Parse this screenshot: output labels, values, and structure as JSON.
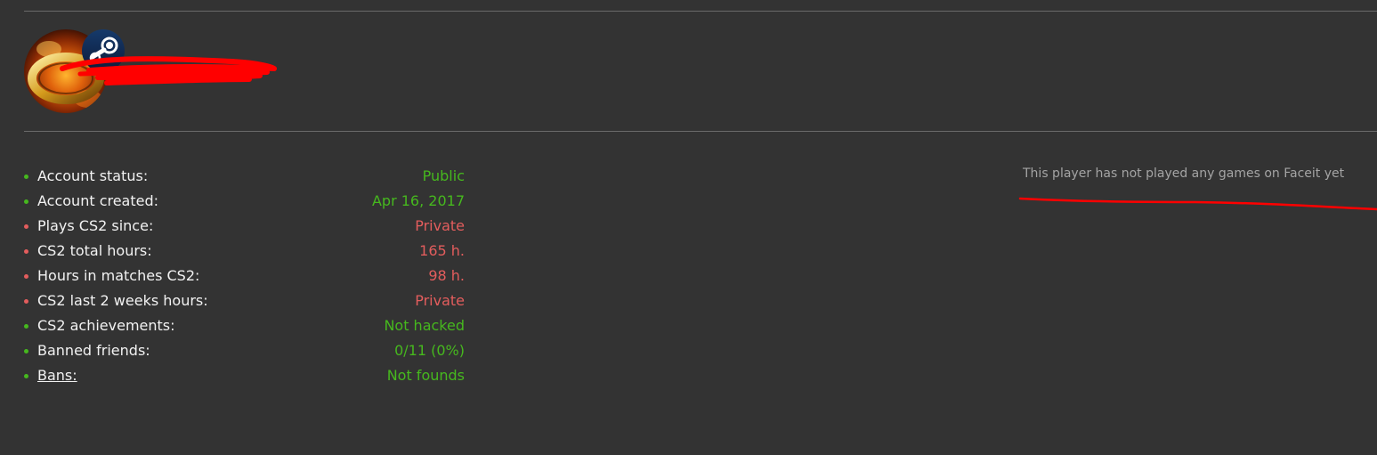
{
  "profile": {
    "avatar_icon": "fire-ring-avatar",
    "badge_icon": "steam-icon",
    "username_redacted": true,
    "redaction_color": "#ff0000"
  },
  "stats": [
    {
      "label": "Account status:",
      "value": "Public",
      "status": "good"
    },
    {
      "label": "Account created:",
      "value": "Apr 16, 2017",
      "status": "good"
    },
    {
      "label": "Plays CS2 since:",
      "value": "Private",
      "status": "bad"
    },
    {
      "label": "CS2 total hours:",
      "value": "165 h.",
      "status": "bad"
    },
    {
      "label": "Hours in matches CS2:",
      "value": "98 h.",
      "status": "bad"
    },
    {
      "label": "CS2 last 2 weeks hours:",
      "value": "Private",
      "status": "bad"
    },
    {
      "label": "CS2 achievements:",
      "value": "Not hacked",
      "status": "good"
    },
    {
      "label": "Banned friends:",
      "value": "0/11 (0%)",
      "status": "good"
    },
    {
      "label": "Bans:",
      "value": "Not founds",
      "status": "good",
      "link": true
    }
  ],
  "faceit": {
    "message": "This player has not played any games on Faceit yet"
  },
  "colors": {
    "background": "#333333",
    "good": "#46b81e",
    "bad": "#e35d5d",
    "muted": "#a4a4a4"
  }
}
